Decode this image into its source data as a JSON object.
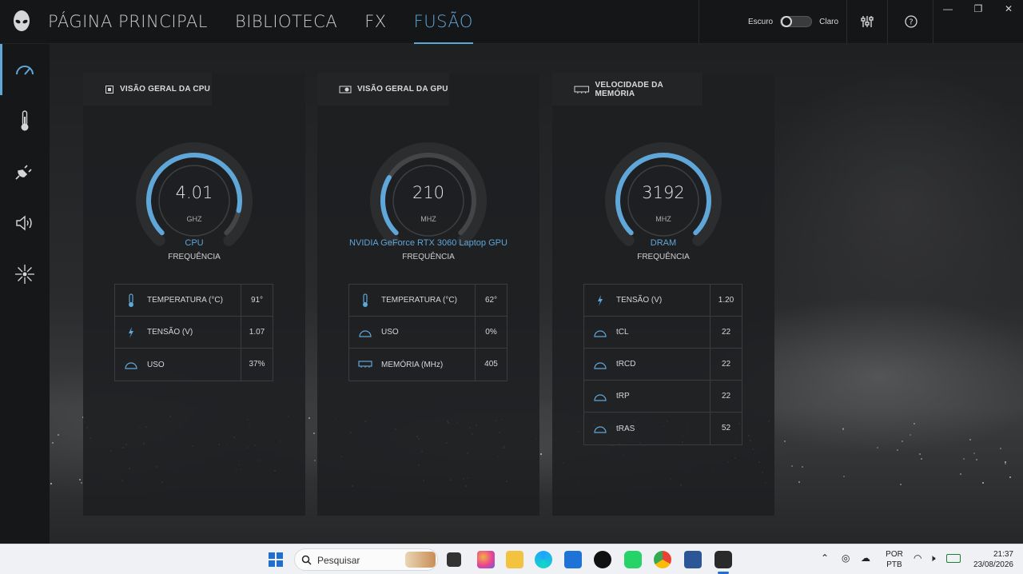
{
  "nav": {
    "tabs": [
      {
        "label": "PÁGINA PRINCIPAL"
      },
      {
        "label": "BIBLIOTECA"
      },
      {
        "label": "FX"
      },
      {
        "label": "FUSÃO"
      }
    ],
    "active_tab": "FUSÃO"
  },
  "theme": {
    "dark_label": "Escuro",
    "light_label": "Claro"
  },
  "accent_color": "#5fa6d9",
  "sidebar": {
    "items": [
      {
        "icon": "speedometer-icon",
        "active": true
      },
      {
        "icon": "thermometer-icon"
      },
      {
        "icon": "power-plug-icon"
      },
      {
        "icon": "speaker-icon"
      },
      {
        "icon": "lighting-burst-icon"
      }
    ]
  },
  "panels": {
    "cpu": {
      "title": "VISÃO GERAL DA CPU",
      "gauge": {
        "value": "4.01",
        "unit": "GHZ",
        "name": "CPU",
        "subtitle": "FREQUÊNCIA",
        "fill": 0.88
      },
      "stats": [
        {
          "icon": "thermometer-icon",
          "label": "TEMPERATURA (°C)",
          "value": "91°"
        },
        {
          "icon": "lightning-icon",
          "label": "TENSÃO (V)",
          "value": "1.07"
        },
        {
          "icon": "usage-gauge-icon",
          "label": "USO",
          "value": "37%"
        }
      ]
    },
    "gpu": {
      "title": "VISÃO GERAL DA GPU",
      "gauge": {
        "value": "210",
        "unit": "MHZ",
        "name": "NVIDIA GeForce RTX 3060 Laptop GPU",
        "subtitle": "FREQUÊNCIA",
        "fill": 0.28
      },
      "stats": [
        {
          "icon": "thermometer-icon",
          "label": "TEMPERATURA (°C)",
          "value": "62°"
        },
        {
          "icon": "usage-gauge-icon",
          "label": "USO",
          "value": "0%"
        },
        {
          "icon": "memory-chip-icon",
          "label": "MEMÓRIA (MHz)",
          "value": "405"
        }
      ]
    },
    "memory": {
      "title": "VELOCIDADE DA MEMÓRIA",
      "gauge": {
        "value": "3192",
        "unit": "MHZ",
        "name": "DRAM",
        "subtitle": "FREQUÊNCIA",
        "fill": 1.0
      },
      "stats": [
        {
          "icon": "lightning-icon",
          "label": "TENSÃO (V)",
          "value": "1.20"
        },
        {
          "icon": "usage-gauge-icon",
          "label": "tCL",
          "value": "22"
        },
        {
          "icon": "usage-gauge-icon",
          "label": "tRCD",
          "value": "22"
        },
        {
          "icon": "usage-gauge-icon",
          "label": "tRP",
          "value": "22"
        },
        {
          "icon": "usage-gauge-icon",
          "label": "tRAS",
          "value": "52"
        }
      ]
    }
  },
  "taskbar": {
    "search_placeholder": "Pesquisar",
    "language": "POR",
    "layout": "PTB",
    "time": "21:37",
    "date": "23/08/2026"
  }
}
